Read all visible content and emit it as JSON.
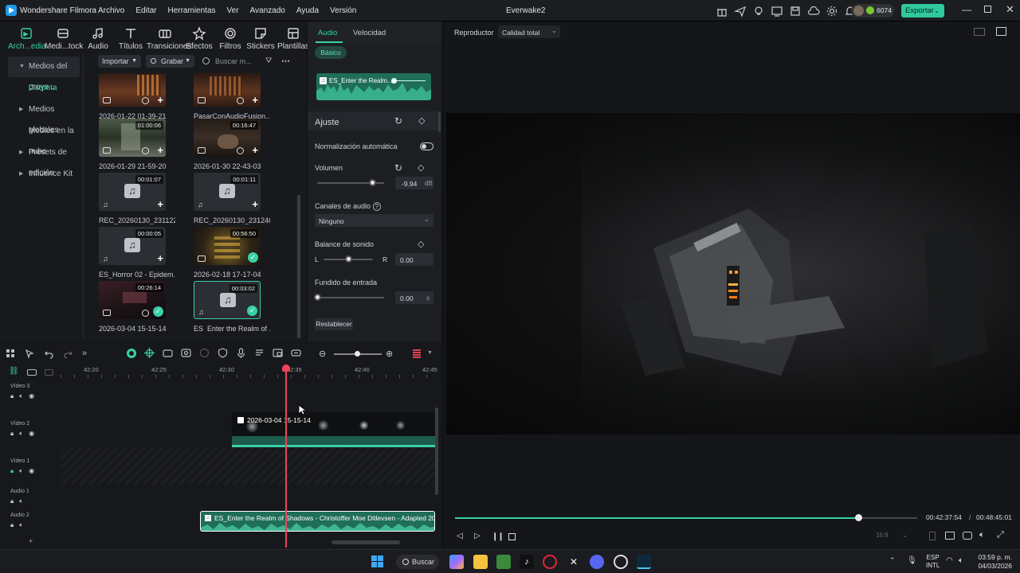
{
  "app": {
    "name": "Wondershare Filmora",
    "project": "Everwake2",
    "credits": "6074",
    "export_label": "Exportar"
  },
  "menu": [
    "Archivo",
    "Editar",
    "Herramientas",
    "Ver",
    "Avanzado",
    "Ayuda",
    "Versión"
  ],
  "tools": [
    {
      "label": "Arch...edia",
      "icon": "media-icon"
    },
    {
      "label": "Medi...tock",
      "icon": "stock-media-icon"
    },
    {
      "label": "Audio",
      "icon": "audio-icon"
    },
    {
      "label": "Títulos",
      "icon": "titles-icon"
    },
    {
      "label": "Transiciones",
      "icon": "transitions-icon"
    },
    {
      "label": "Efectos",
      "icon": "effects-icon"
    },
    {
      "label": "Filtros",
      "icon": "filters-icon"
    },
    {
      "label": "Stickers",
      "icon": "stickers-icon"
    },
    {
      "label": "Plantillas",
      "icon": "templates-icon"
    }
  ],
  "sidebar": [
    {
      "label": "Medios del proye...",
      "caret": true
    },
    {
      "label": "Carpeta",
      "caret": false
    },
    {
      "label": "Medios globales",
      "caret": true
    },
    {
      "label": "Medios en la nube",
      "caret": false
    },
    {
      "label": "Presets de edición",
      "caret": true
    },
    {
      "label": "Influence Kit",
      "caret": true
    }
  ],
  "media_bar": {
    "import": "Importar",
    "record": "Grabar",
    "search_placeholder": "Buscar m..."
  },
  "media": [
    {
      "name": "2026-01-22 01-39-21",
      "duration": "",
      "kind": "video"
    },
    {
      "name": "PasarConAudioFusion...",
      "duration": "",
      "kind": "video"
    },
    {
      "name": "2026-01-29 21-59-20",
      "duration": "01:00:06",
      "kind": "video"
    },
    {
      "name": "2026-01-30 22-43-03",
      "duration": "00:16:47",
      "kind": "video"
    },
    {
      "name": "REC_20260130_231122",
      "duration": "00:01:07",
      "kind": "audio"
    },
    {
      "name": "REC_20260130_231246",
      "duration": "00:01:11",
      "kind": "audio"
    },
    {
      "name": "ES_Horror 02 - Epidem...",
      "duration": "00:00:05",
      "kind": "audio"
    },
    {
      "name": "2026-02-18 17-17-04",
      "duration": "00:56:50",
      "kind": "video"
    },
    {
      "name": "2026-03-04 15-15-14",
      "duration": "00:26:14",
      "kind": "video"
    },
    {
      "name": "ES_Enter the Realm of ...",
      "duration": "00:03:02",
      "kind": "audio"
    }
  ],
  "props": {
    "tabs": [
      "Audio",
      "Velocidad"
    ],
    "subtab": "Básico",
    "clip_name": "ES_Enter the Realm...",
    "ajuste": "Ajuste",
    "normalization": "Normalización automática",
    "volume_label": "Volumen",
    "volume_value": "-9.94",
    "volume_unit": "dB",
    "volume_level": 0.83,
    "channels_label": "Canales de audio",
    "channels_value": "Ninguno",
    "balance_label": "Balance de sonido",
    "balance_l": "L",
    "balance_r": "R",
    "balance_value": "0.00",
    "balance_level": 0.5,
    "fade_in_label": "Fundido de entrada",
    "fade_in_value": "0.00",
    "fade_in_unit": "s",
    "fade_in_level": 0,
    "reset": "Restablecer"
  },
  "player": {
    "label": "Reproductor",
    "quality": "Calidad total",
    "current": "00:42:37:54",
    "sep": "/",
    "total": "00:48:45:01",
    "progress": 0.874,
    "ratio": "16:9"
  },
  "timeline": {
    "ruler": [
      "42:20",
      "42:25",
      "42:30",
      "42:35",
      "42:40",
      "42:45"
    ],
    "playhead_fraction": 0.6,
    "tracks": [
      "Vídeo 3",
      "Vídeo 2",
      "Vídeo 1",
      "Audio 1",
      "Audio 2"
    ],
    "video_clip": "2026-03-04 15-15-14",
    "audio_clip": "ES_Enter the Realm of Shadows - Christoffer Moe Ditlevsen - Adapted 2026-03-"
  },
  "taskbar": {
    "search": "Buscar",
    "lang1": "ESP",
    "lang2": "INTL",
    "time": "03:59 p. m.",
    "date": "04/03/2026"
  },
  "colors": {
    "accent": "#3ad0a8",
    "playhead": "#f0435a"
  }
}
